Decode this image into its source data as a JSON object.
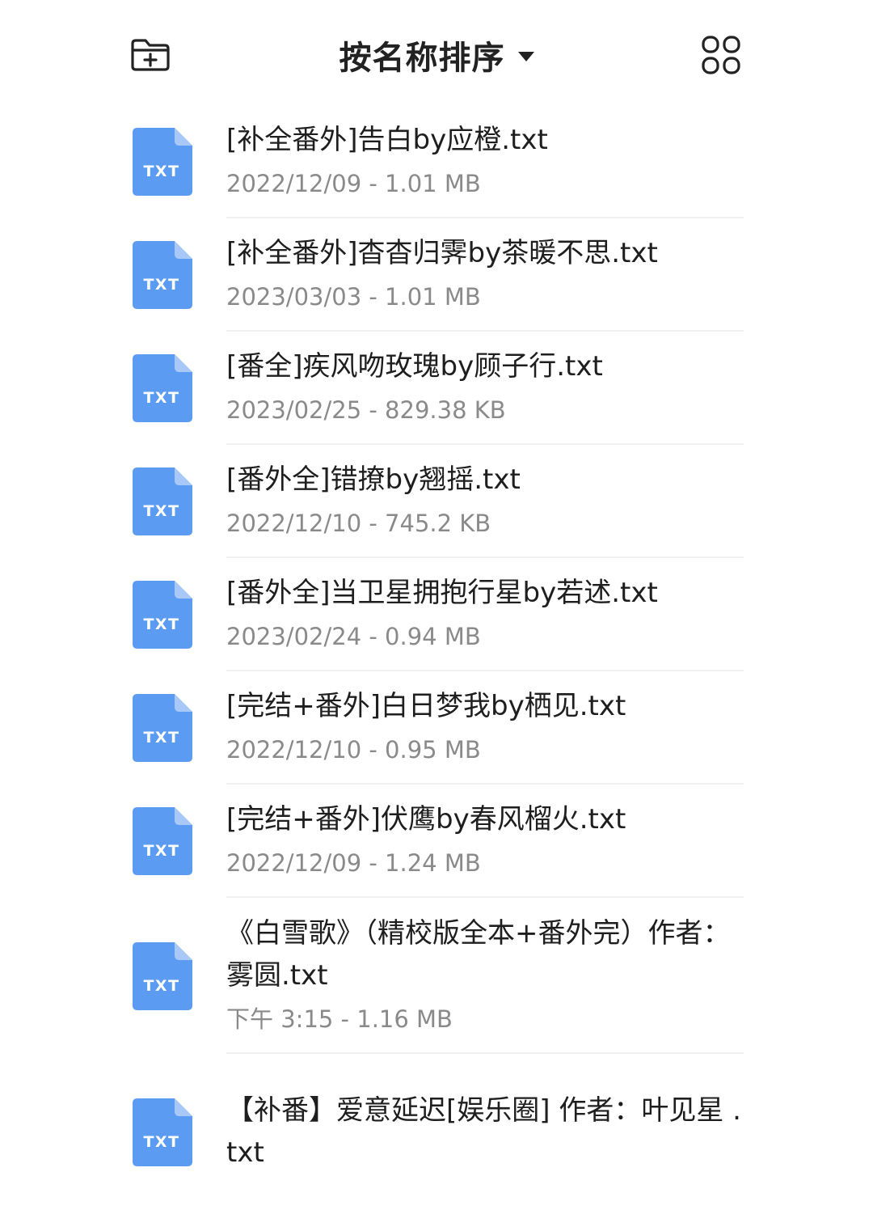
{
  "header": {
    "sort_label": "按名称排序",
    "new_folder_icon": "new-folder-icon",
    "grid_view_icon": "grid-view-icon"
  },
  "colors": {
    "icon_blue": "#5b9cf2",
    "icon_fold": "#a8c9f7",
    "meta_gray": "#8a8a8a"
  },
  "file_badge": "TXT",
  "files": [
    {
      "name": "[补全番外]告白by应橙.txt",
      "date": "2022/12/09",
      "size": "1.01 MB"
    },
    {
      "name": "[补全番外]杳杳归霁by茶暖不思.txt",
      "date": "2023/03/03",
      "size": "1.01 MB"
    },
    {
      "name": "[番全]疾风吻玫瑰by顾子行.txt",
      "date": "2023/02/25",
      "size": "829.38 KB"
    },
    {
      "name": "[番外全]错撩by翘摇.txt",
      "date": "2022/12/10",
      "size": "745.2 KB"
    },
    {
      "name": "[番外全]当卫星拥抱行星by若述.txt",
      "date": "2023/02/24",
      "size": "0.94 MB"
    },
    {
      "name": "[完结+番外]白日梦我by栖见.txt",
      "date": "2022/12/10",
      "size": "0.95 MB"
    },
    {
      "name": "[完结+番外]伏鹰by春风榴火.txt",
      "date": "2022/12/09",
      "size": "1.24 MB"
    },
    {
      "name": "《白雪歌》（精校版全本+番外完）作者：雾圆.txt",
      "date": "下午 3:15 ",
      "size": "1.16 MB"
    },
    {
      "name": "【补番】爱意延迟[娱乐圈] 作者：叶见星 .txt",
      "date": "",
      "size": ""
    }
  ]
}
